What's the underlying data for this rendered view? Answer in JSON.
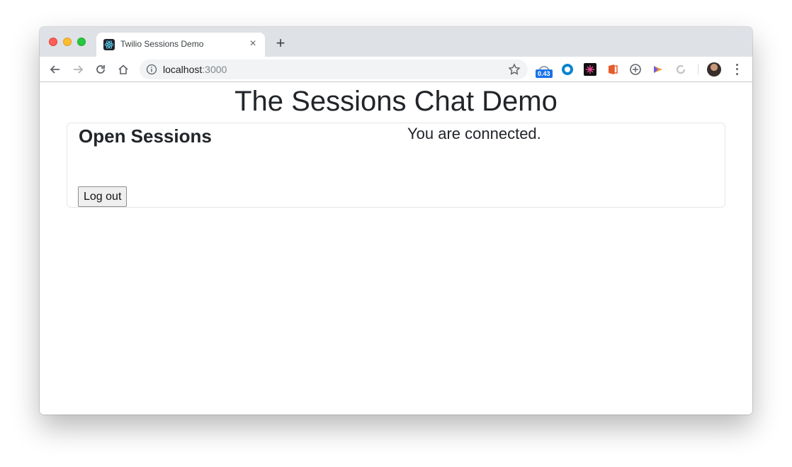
{
  "browser": {
    "tab": {
      "title": "Twilio Sessions Demo",
      "close_glyph": "×"
    },
    "new_tab_glyph": "+",
    "address": {
      "host": "localhost",
      "port": ":3000"
    },
    "extensions": {
      "speed_badge": "0.43"
    }
  },
  "page": {
    "title": "The Sessions Chat Demo",
    "sessions_heading": "Open Sessions",
    "status": "You are connected.",
    "logout_label": "Log out"
  },
  "colors": {
    "tabstrip": "#dee1e6",
    "text": "#212529",
    "badge": "#1a73e8"
  }
}
